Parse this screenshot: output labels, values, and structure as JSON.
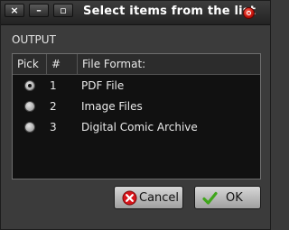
{
  "window": {
    "title": "Select items from the list",
    "controls": {
      "close": "×",
      "minimize": "–",
      "maximize": "▫"
    }
  },
  "section_label": "OUTPUT",
  "table": {
    "columns": [
      "Pick",
      "#",
      "File Format:"
    ],
    "rows": [
      {
        "picked": true,
        "num": "1",
        "format": "PDF File"
      },
      {
        "picked": false,
        "num": "2",
        "format": "Image Files"
      },
      {
        "picked": false,
        "num": "3",
        "format": "Digital Comic Archive"
      }
    ]
  },
  "buttons": {
    "cancel_label": "Cancel",
    "ok_label": "OK",
    "cancel_icon": "cancel-icon",
    "ok_icon": "checkmark-icon"
  },
  "colors": {
    "background": "#3b3b3b",
    "list_background": "#111111",
    "title_dot": "#c4120a",
    "ok_check": "#3fa61b",
    "cancel_x": "#d8141a"
  }
}
